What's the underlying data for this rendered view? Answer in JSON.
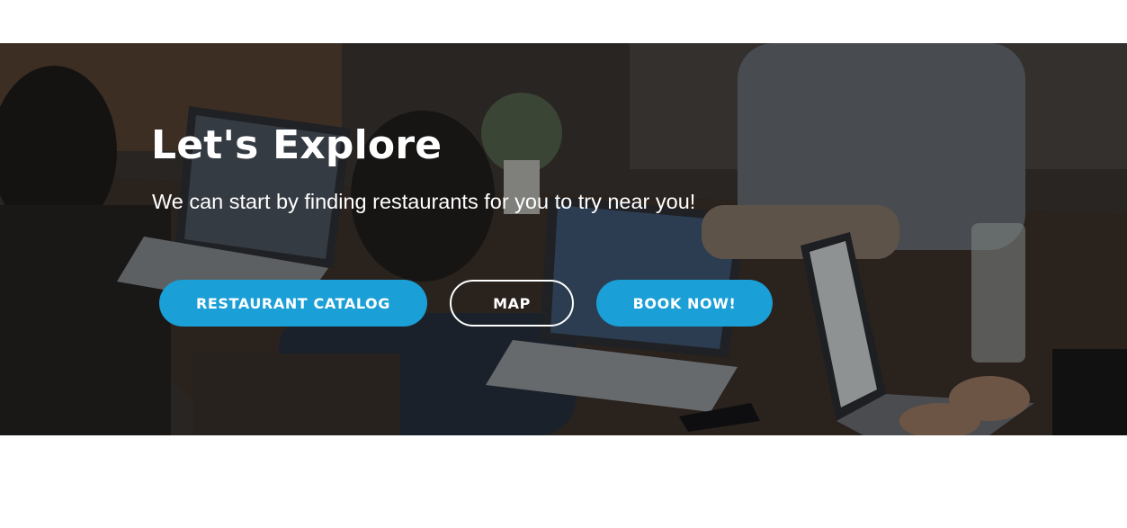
{
  "hero": {
    "title": "Let's Explore",
    "subtitle": "We can start by finding restaurants for you to try near you!",
    "overlay_color": "#0a0a0a"
  },
  "actions": {
    "catalog_label": "RESTAURANT CATALOG",
    "map_label": "MAP",
    "book_label": "BOOK NOW!",
    "accent_color": "#1a9fd6"
  }
}
